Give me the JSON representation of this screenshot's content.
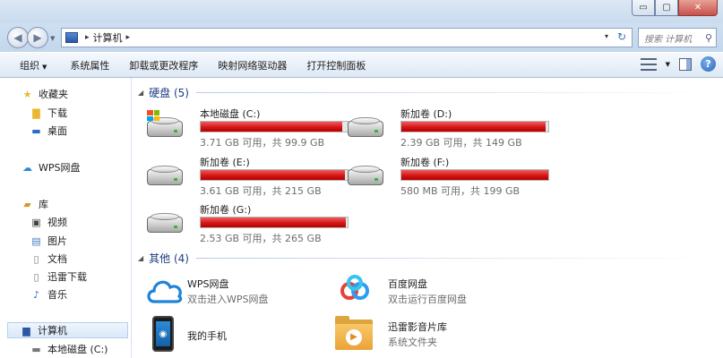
{
  "window": {
    "buttons": {
      "minimize": "▭",
      "maximize": "▢",
      "close": "✕"
    }
  },
  "address": {
    "arrow1": "▸",
    "path": "计算机",
    "arrow2": "▸",
    "dropdown": "▾",
    "refresh": "↻"
  },
  "search": {
    "placeholder": "搜索 计算机",
    "icon": "search-icon"
  },
  "toolbar": {
    "organize": "组织",
    "items": [
      "系统属性",
      "卸载或更改程序",
      "映射网络驱动器",
      "打开控制面板"
    ]
  },
  "sidebar": {
    "favorites": {
      "label": "收藏夹",
      "items": [
        "下载",
        "桌面"
      ]
    },
    "wps": {
      "label": "WPS网盘"
    },
    "libraries": {
      "label": "库",
      "items": [
        "视频",
        "图片",
        "文档",
        "迅雷下载",
        "音乐"
      ]
    },
    "computer": {
      "label": "计算机",
      "items": [
        "本地磁盘 (C:)"
      ]
    }
  },
  "groups": {
    "drives": {
      "title": "硬盘 (5)"
    },
    "other": {
      "title": "其他 (4)"
    }
  },
  "drives": [
    {
      "name": "本地磁盘 (C:)",
      "free": "3.71 GB 可用，共 99.9 GB",
      "used_fraction": 0.963,
      "system": true
    },
    {
      "name": "新加卷 (D:)",
      "free": "2.39 GB 可用，共 149 GB",
      "used_fraction": 0.984,
      "system": false
    },
    {
      "name": "新加卷 (E:)",
      "free": "3.61 GB 可用，共 215 GB",
      "used_fraction": 0.983,
      "system": false
    },
    {
      "name": "新加卷 (F:)",
      "free": "580 MB 可用，共 199 GB",
      "used_fraction": 0.997,
      "system": false
    },
    {
      "name": "新加卷 (G:)",
      "free": "2.53 GB 可用，共 265 GB",
      "used_fraction": 0.99,
      "system": false
    }
  ],
  "others": [
    {
      "name": "WPS网盘",
      "sub": "双击进入WPS网盘"
    },
    {
      "name": "百度网盘",
      "sub": "双击运行百度网盘"
    },
    {
      "name": "我的手机",
      "sub": ""
    },
    {
      "name": "迅雷影音片库",
      "sub": "系统文件夹"
    }
  ],
  "colors": {
    "usage_bar": "#d21111",
    "group_header": "#1e3c82"
  }
}
